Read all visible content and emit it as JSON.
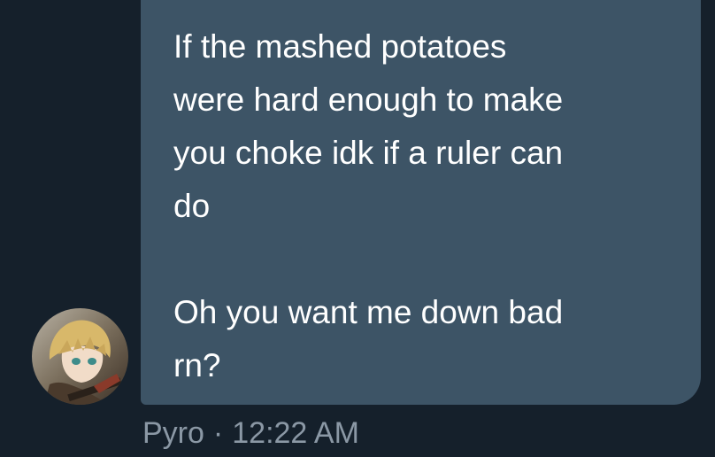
{
  "dm": {
    "message": {
      "text": "If the mashed potatoes\nwere hard enough to make\nyou choke idk if a ruler can\ndo\n\nOh you want me down bad\nrn?"
    },
    "sender": {
      "name": "Pyro",
      "separator": "·",
      "timestamp": "12:22 AM",
      "avatar_icon": "anime-character-avatar"
    }
  },
  "colors": {
    "background": "#15202b",
    "bubble": "#3d5466",
    "message_text": "#ffffff",
    "meta_text": "#8b98a5"
  }
}
